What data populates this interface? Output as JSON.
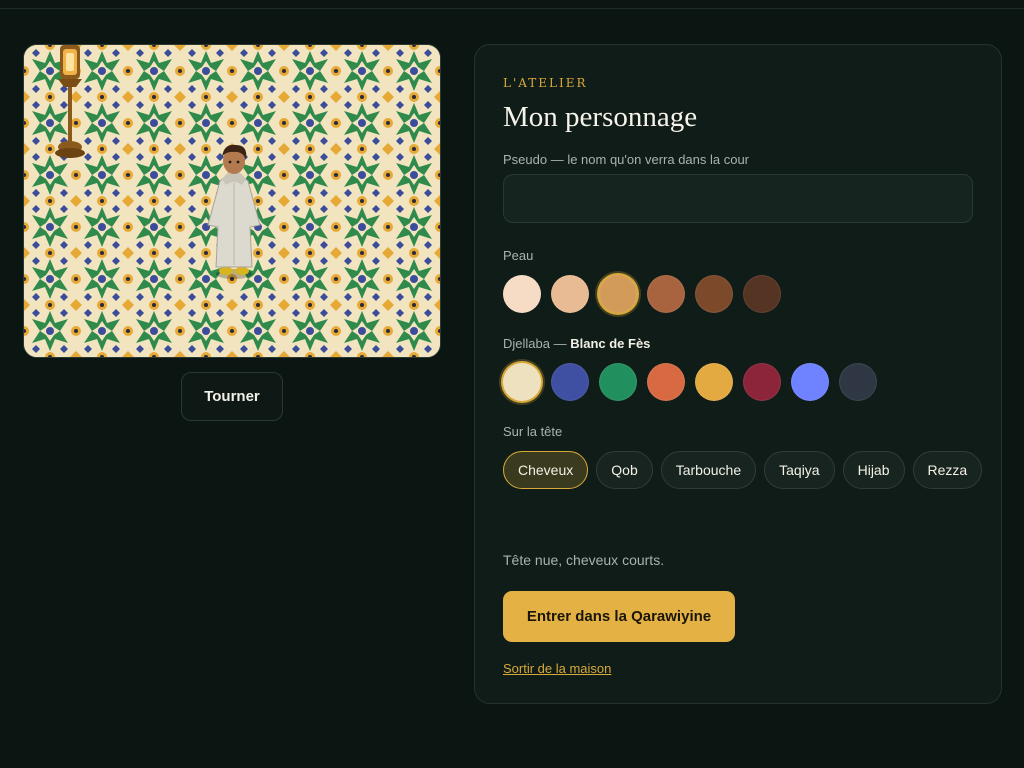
{
  "preview": {
    "rotate_label": "Tourner"
  },
  "panel": {
    "eyebrow": "L'ATELIER",
    "title": "Mon personnage",
    "name_label": "Pseudo — le nom qu'on verra dans la cour",
    "name_value": "",
    "skin_label": "Peau",
    "skin_colors": [
      "#f6dcc4",
      "#e9bb95",
      "#d39b5a",
      "#a8643f",
      "#7c4a2b",
      "#563424"
    ],
    "skin_selected_index": 2,
    "djellaba_label": "Djellaba —",
    "djellaba_selected_name": "Blanc de Fès",
    "djellaba_colors": [
      "#eee1bf",
      "#3f4fa1",
      "#22905e",
      "#d86a43",
      "#e3aa42",
      "#8c2539",
      "#6f82ff",
      "#2e3743"
    ],
    "djellaba_selected_index": 0,
    "head_label": "Sur la tête",
    "head_options": [
      "Cheveux",
      "Qob",
      "Tarbouche",
      "Taqiya",
      "Hijab",
      "Rezza"
    ],
    "head_selected_index": 0,
    "head_description": "Tête nue, cheveux courts.",
    "enter_label": "Entrer dans la Qarawiyine",
    "exit_label": "Sortir de la maison"
  },
  "colors": {
    "accent": "#e4b244",
    "background": "#0b1612",
    "panel": "#0f1c17"
  },
  "icons": [
    "lantern-icon",
    "avatar-icon"
  ]
}
